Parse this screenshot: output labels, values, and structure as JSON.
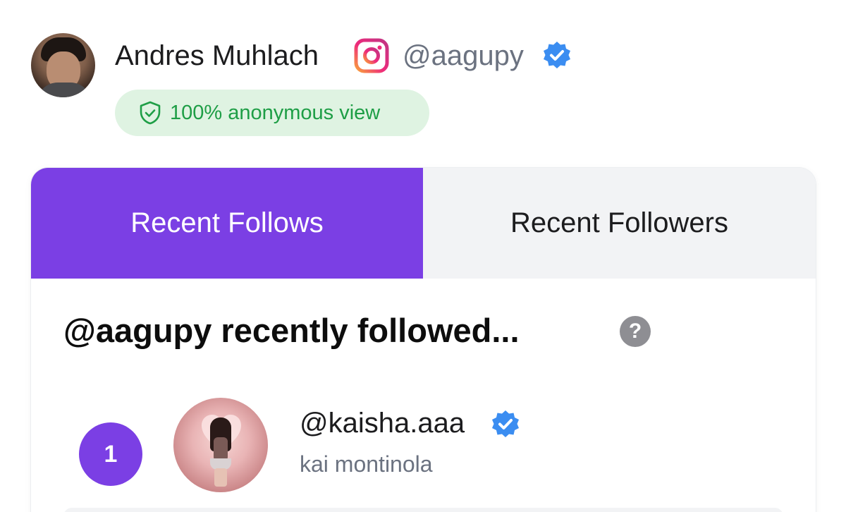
{
  "profile": {
    "name": "Andres Muhlach",
    "platform_icon": "instagram-icon",
    "handle": "@aagupy",
    "verified": true,
    "anonymous_badge": "100% anonymous view"
  },
  "tabs": [
    {
      "label": "Recent Follows",
      "active": true
    },
    {
      "label": "Recent Followers",
      "active": false
    }
  ],
  "section": {
    "title": "@aagupy recently followed...",
    "help_icon": "?"
  },
  "items": [
    {
      "rank": "1",
      "handle": "@kaisha.aaa",
      "verified": true,
      "name": "kai montinola"
    }
  ],
  "colors": {
    "accent": "#7b3fe4",
    "verified": "#3b8df1",
    "badge_bg": "#dff3e2",
    "badge_text": "#1e9e46",
    "inactive_tab_bg": "#f2f3f5"
  }
}
